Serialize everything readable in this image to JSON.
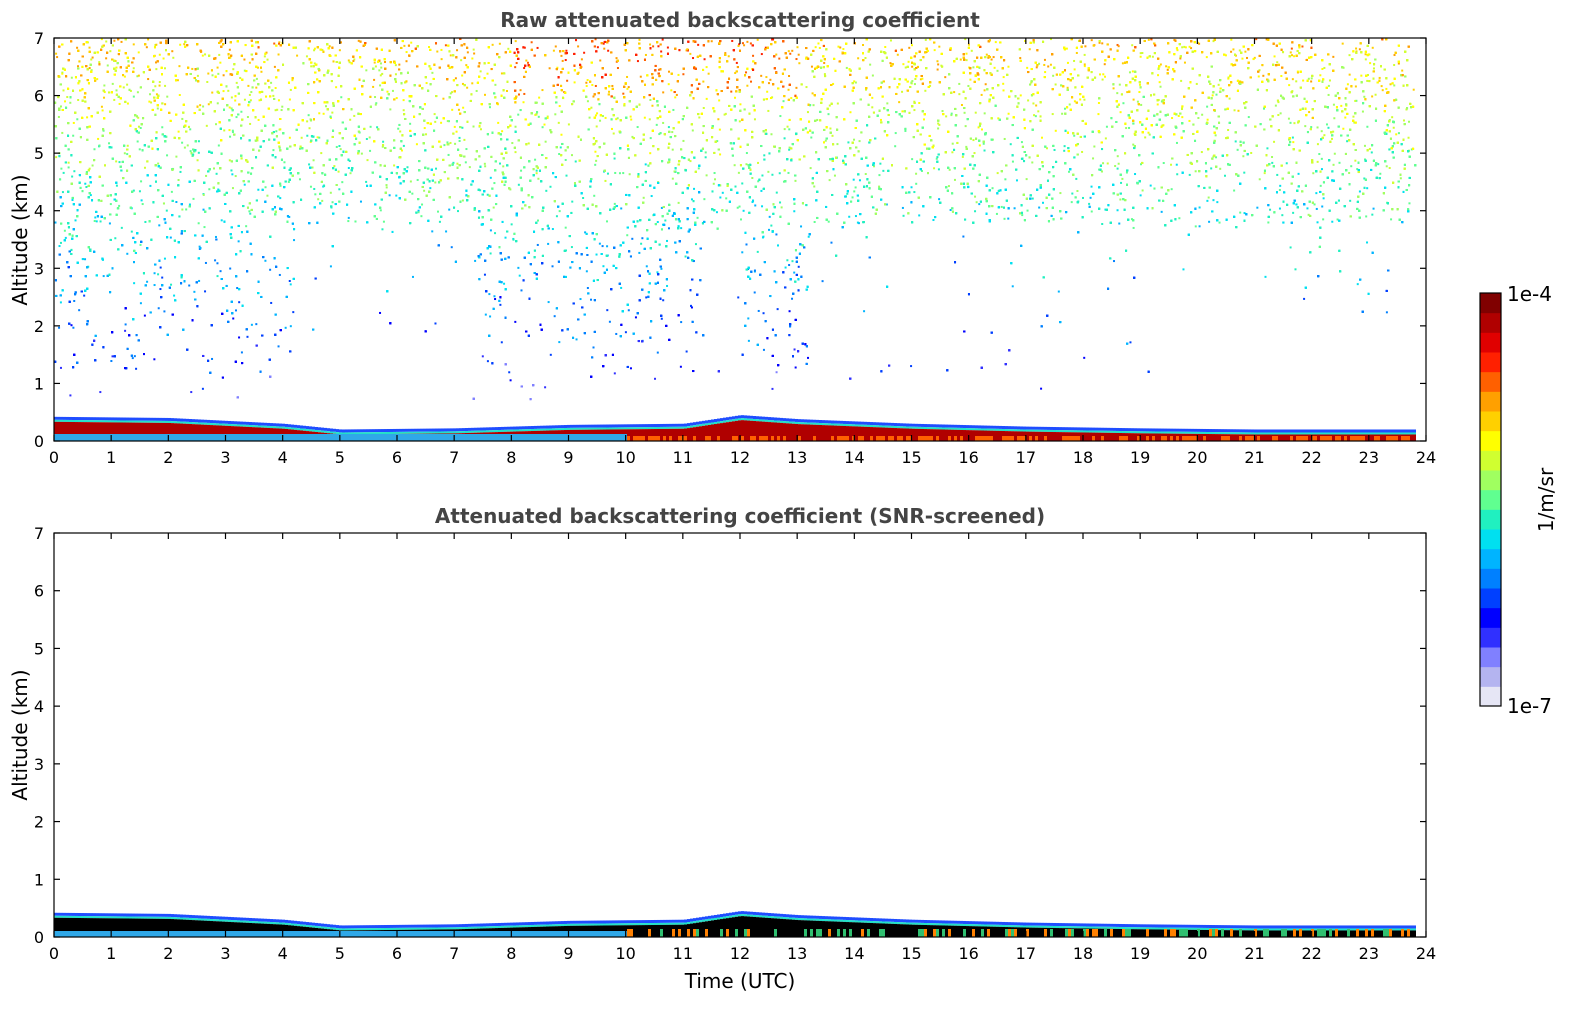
{
  "chart_data": [
    {
      "type": "heatmap",
      "title": "Raw attenuated backscattering coefficient",
      "xlabel": "",
      "ylabel": "Altitude (km)",
      "xlim": [
        0,
        24
      ],
      "ylim": [
        0,
        7
      ],
      "xticks": [
        "0",
        "1",
        "2",
        "3",
        "4",
        "5",
        "6",
        "7",
        "8",
        "9",
        "10",
        "11",
        "12",
        "13",
        "14",
        "15",
        "16",
        "17",
        "18",
        "19",
        "20",
        "21",
        "22",
        "23",
        "24"
      ],
      "yticks": [
        "0",
        "1",
        "2",
        "3",
        "4",
        "5",
        "6",
        "7"
      ],
      "screened": false,
      "features": {
        "boundary_layer_top_km": [
          [
            0,
            0.42
          ],
          [
            2,
            0.4
          ],
          [
            4,
            0.3
          ],
          [
            5,
            0.2
          ],
          [
            7,
            0.22
          ],
          [
            9,
            0.28
          ],
          [
            11,
            0.3
          ],
          [
            12,
            0.45
          ],
          [
            13,
            0.38
          ],
          [
            15,
            0.3
          ],
          [
            17,
            0.25
          ],
          [
            19,
            0.22
          ],
          [
            21,
            0.2
          ],
          [
            23.8,
            0.2
          ]
        ],
        "noise_rises_with_altitude": true
      }
    },
    {
      "type": "heatmap",
      "title": "Attenuated backscattering coefficient (SNR-screened)",
      "xlabel": "Time (UTC)",
      "ylabel": "Altitude (km)",
      "xlim": [
        0,
        24
      ],
      "ylim": [
        0,
        7
      ],
      "xticks": [
        "0",
        "1",
        "2",
        "3",
        "4",
        "5",
        "6",
        "7",
        "8",
        "9",
        "10",
        "11",
        "12",
        "13",
        "14",
        "15",
        "16",
        "17",
        "18",
        "19",
        "20",
        "21",
        "22",
        "23",
        "24"
      ],
      "yticks": [
        "0",
        "1",
        "2",
        "3",
        "4",
        "5",
        "6",
        "7"
      ],
      "screened": true
    }
  ],
  "colorbar": {
    "max_label": "1e-4",
    "min_label": "1e-7",
    "unit_label": "1/m/sr",
    "scale": "log",
    "colors": [
      "#e6e6f5",
      "#b4b4f0",
      "#8080ff",
      "#3030ff",
      "#0000ff",
      "#0040ff",
      "#0080ff",
      "#00b4ff",
      "#00e0f0",
      "#20f0c0",
      "#60ff90",
      "#a0ff60",
      "#d0ff30",
      "#ffff00",
      "#ffd000",
      "#ffa000",
      "#ff6000",
      "#ff2000",
      "#e00000",
      "#b00000",
      "#800000"
    ]
  }
}
